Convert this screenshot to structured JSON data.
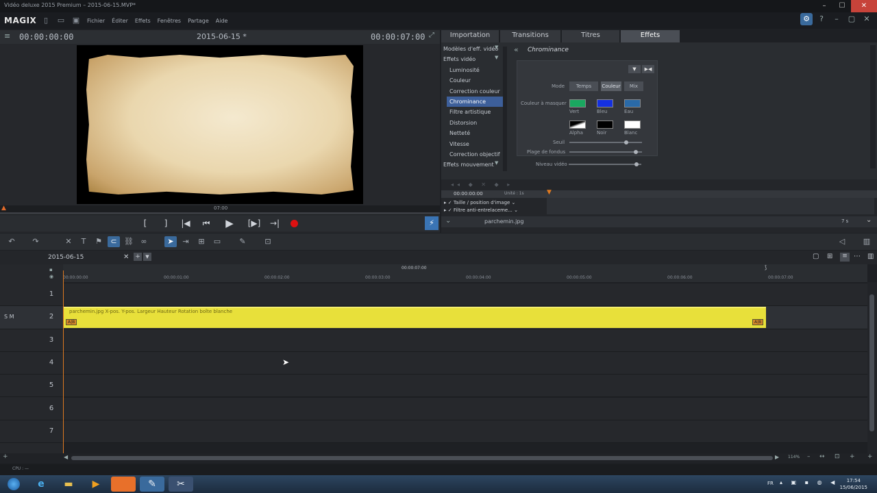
{
  "window": {
    "title": "Vidéo deluxe 2015 Premium – 2015-06-15.MVP*"
  },
  "menu": {
    "logo": "MAGIX",
    "items": [
      "Fichier",
      "Éditer",
      "Effets",
      "Fenêtres",
      "Partage",
      "Aide"
    ]
  },
  "preview": {
    "timecode_left": "00:00:00:00",
    "title": "2015-06-15 *",
    "timecode_right": "00:00:07:00",
    "scrub_label": "07:00"
  },
  "fx": {
    "tabs": [
      "Importation",
      "Transitions",
      "Titres",
      "Effets"
    ],
    "active_tab": "Effets",
    "list": [
      {
        "label": "Modèles d'eff. vidéo",
        "group": true
      },
      {
        "label": "Effets vidéo",
        "group": true
      },
      {
        "label": "Luminosité"
      },
      {
        "label": "Couleur"
      },
      {
        "label": "Correction couleur"
      },
      {
        "label": "Chrominance",
        "selected": true
      },
      {
        "label": "Filtre artistique"
      },
      {
        "label": "Distorsion"
      },
      {
        "label": "Netteté"
      },
      {
        "label": "Vitesse"
      },
      {
        "label": "Correction objectif"
      },
      {
        "label": "Effets mouvement",
        "group": true
      }
    ],
    "detail": {
      "title": "Chrominance",
      "mode_label": "Mode",
      "modes": [
        "Temps",
        "Couleur",
        "Mix"
      ],
      "mask_label": "Couleur à masquer",
      "swatches": [
        {
          "name": "Vert",
          "color": "#1aa860"
        },
        {
          "name": "Bleu",
          "color": "#1430e0"
        },
        {
          "name": "Eau",
          "color": "#2a6aa8"
        },
        {
          "name": "Alpha",
          "color": "#ffffff"
        },
        {
          "name": "Noir",
          "color": "#000000"
        },
        {
          "name": "Blanc",
          "color": "#ffffff"
        }
      ],
      "threshold_label": "Seuil",
      "range_label": "Plage de fondus",
      "video_level_label": "Niveau vidéo"
    }
  },
  "keyframes": {
    "timecode": "00:00:00:00",
    "unit": "Unité : 1s",
    "rows": [
      "Taille / position d'image",
      "Filtre anti-entrelaceme..."
    ],
    "clip_name": "parchemin.jpg",
    "duration": "7 s"
  },
  "timeline": {
    "tab": "2015-06-15",
    "ruler_center": "00:00:07:00",
    "ticks": [
      "00:00:00:00",
      "00:00:01:00",
      "00:00:02:00",
      "00:00:03:00",
      "00:00:04:00",
      "00:00:05:00",
      "00:00:06:00",
      "00:00:07:00"
    ],
    "tracks": [
      "1",
      "2",
      "3",
      "4",
      "5",
      "6",
      "7"
    ],
    "track_controls": "S M",
    "clip_label": "parchemin.jpg   X-pos.  Y-pos.  Largeur  Hauteur  Rotation boîte blanche",
    "zoom": "114%"
  },
  "status": {
    "cpu": "CPU : —"
  },
  "taskbar": {
    "lang": "FR",
    "time": "17:54",
    "date": "15/06/2015"
  }
}
